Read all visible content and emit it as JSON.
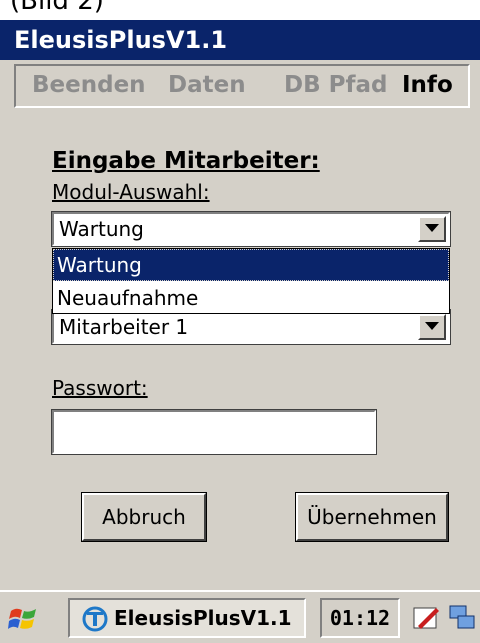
{
  "caption": "(Bild 2)",
  "window": {
    "title": "EleusisPlusV1.1"
  },
  "menu": {
    "items": [
      "Beenden",
      "Daten",
      "DB Pfad",
      "Info"
    ],
    "active": "Info"
  },
  "form": {
    "heading": "Eingabe Mitarbeiter:",
    "module_label": "Modul-Auswahl:",
    "module_value": "Wartung",
    "module_options": [
      "Wartung",
      "Neuaufnahme"
    ],
    "module_selected_option": "Wartung",
    "employee_value": "Mitarbeiter 1",
    "password_label": "Passwort:",
    "password_value": ""
  },
  "buttons": {
    "cancel": "Abbruch",
    "apply": "Übernehmen"
  },
  "taskbar": {
    "task_label": "EleusisPlusV1.1",
    "clock": "01:12"
  },
  "icons": {
    "start": "windows-flag-icon",
    "app": "app-icon",
    "dropdown": "triangle-down-icon",
    "tray1": "pen-input-icon",
    "tray2": "network-icon"
  },
  "colors": {
    "titlebar": "#0a246a",
    "selection": "#0a246a",
    "face": "#d4d0c8"
  }
}
